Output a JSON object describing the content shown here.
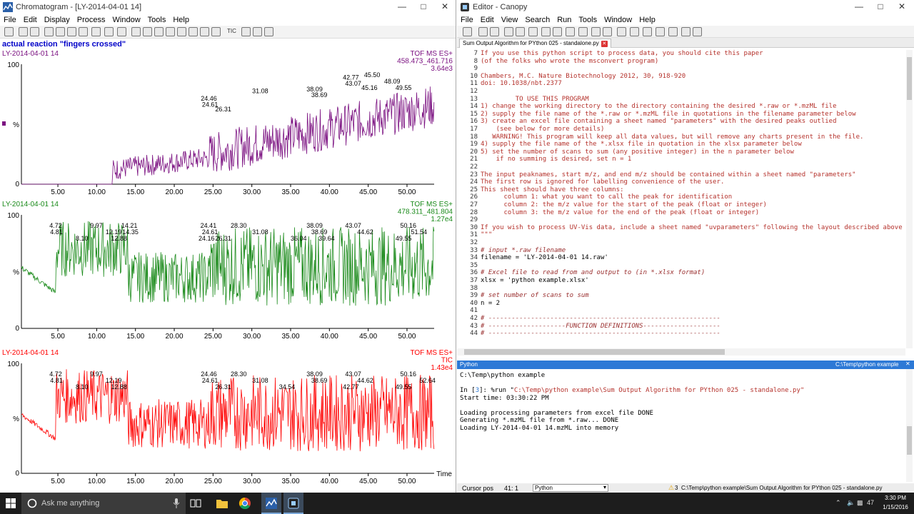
{
  "chromatogram": {
    "title": "Chromatogram - [LY-2014-04-01 14]",
    "menu": [
      "File",
      "Edit",
      "Display",
      "Process",
      "Window",
      "Tools",
      "Help"
    ],
    "toolbar_text": "TIC",
    "heading": "actual reaction \"fingers crossed\"",
    "time_label": "Time",
    "charts": [
      {
        "sample": "LY-2014-04-01 14",
        "method": "TOF MS ES+",
        "range": "458.473_461.716",
        "intensity": "3.64e3",
        "color": "#7b1181",
        "peak_labels": [
          "24.46",
          "24.61",
          "26.31",
          "31.08",
          "38.09",
          "38.69",
          "42.77",
          "43.07",
          "45.16",
          "45.50",
          "48.09",
          "49.55"
        ]
      },
      {
        "sample": "LY-2014-04-01 14",
        "method": "TOF MS ES+",
        "range": "478.311_481.804",
        "intensity": "1.27e4",
        "color": "#1a8a1a",
        "peak_labels": [
          "4.72",
          "4.81",
          "8.10",
          "9.97",
          "12.19",
          "12.88",
          "14.21",
          "14.35",
          "24.16",
          "24.41",
          "24.61",
          "26.31",
          "28.30",
          "31.08",
          "36.04",
          "38.09",
          "38.69",
          "39.64",
          "43.07",
          "44.62",
          "49.55",
          "50.16",
          "51.54"
        ]
      },
      {
        "sample": "LY-2014-04-01 14",
        "method": "TOF MS ES+",
        "range": "TIC",
        "intensity": "1.43e4",
        "color": "#ff0000",
        "peak_labels": [
          "4.72",
          "4.81",
          "8.10",
          "9.97",
          "12.19",
          "12.88",
          "24.46",
          "24.61",
          "26.31",
          "28.30",
          "31.08",
          "34.54",
          "38.09",
          "38.69",
          "42.77",
          "43.07",
          "44.62",
          "49.55",
          "50.16",
          "52.64"
        ]
      }
    ],
    "y_ticks": [
      "100",
      "%",
      "0"
    ],
    "x_ticks": [
      "5.00",
      "10.00",
      "15.00",
      "20.00",
      "25.00",
      "30.00",
      "35.00",
      "40.00",
      "45.00",
      "50.00"
    ]
  },
  "editor": {
    "title": "Editor - Canopy",
    "menu": [
      "File",
      "Edit",
      "View",
      "Search",
      "Run",
      "Tools",
      "Window",
      "Help"
    ],
    "tab": "Sum Output Algorithm for PYthon 025 - standalone.py",
    "code_lines": [
      {
        "n": "7",
        "t": "If you use this python script to process data, you should cite this paper",
        "k": "cm"
      },
      {
        "n": "8",
        "t": "(of the folks who wrote the msconvert program)",
        "k": "cm"
      },
      {
        "n": "9",
        "t": "",
        "k": "cm"
      },
      {
        "n": "10",
        "t": "Chambers, M.C. Nature Biotechnology 2012, 30, 918-920",
        "k": "cm"
      },
      {
        "n": "11",
        "t": "doi: 10.1038/nbt.2377",
        "k": "cm"
      },
      {
        "n": "12",
        "t": "",
        "k": "cm"
      },
      {
        "n": "13",
        "t": "         TO USE THIS PROGRAM",
        "k": "cm"
      },
      {
        "n": "14",
        "t": "1) change the working directory to the directory containing the desired *.raw or *.mzML file",
        "k": "cm"
      },
      {
        "n": "15",
        "t": "2) supply the file name of the *.raw or *.mzML file in quotations in the filename parameter below",
        "k": "cm"
      },
      {
        "n": "16",
        "t": "3) create an excel file containing a sheet named \"parameters\" with the desired peaks outlied",
        "k": "cm"
      },
      {
        "n": "17",
        "t": "    (see below for more details)",
        "k": "cm"
      },
      {
        "n": "18",
        "t": "   WARNING! This program will keep all data values, but will remove any charts present in the file.",
        "k": "cm"
      },
      {
        "n": "19",
        "t": "4) supply the file name of the *.xlsx file in quotation in the xlsx parameter below",
        "k": "cm"
      },
      {
        "n": "20",
        "t": "5) set the number of scans to sum (any positive integer) in the n parameter below",
        "k": "cm"
      },
      {
        "n": "21",
        "t": "    if no summing is desired, set n = 1",
        "k": "cm"
      },
      {
        "n": "22",
        "t": "",
        "k": "cm"
      },
      {
        "n": "23",
        "t": "The input peaknames, start m/z, and end m/z should be contained within a sheet named \"parameters\"",
        "k": "cm"
      },
      {
        "n": "24",
        "t": "The first row is ignored for labelling convenience of the user.",
        "k": "cm"
      },
      {
        "n": "25",
        "t": "This sheet should have three columns:",
        "k": "cm"
      },
      {
        "n": "26",
        "t": "      column 1: what you want to call the peak for identification",
        "k": "cm"
      },
      {
        "n": "27",
        "t": "      column 2: the m/z value for the start of the peak (float or integer)",
        "k": "cm"
      },
      {
        "n": "28",
        "t": "      column 3: the m/z value for the end of the peak (float or integer)",
        "k": "cm"
      },
      {
        "n": "29",
        "t": "",
        "k": "cm"
      },
      {
        "n": "30",
        "t": "If you wish to process UV-Vis data, include a sheet named \"uvparameters\" following the layout described above",
        "k": "cm"
      },
      {
        "n": "31",
        "t": "\"\"\"",
        "k": "cm"
      },
      {
        "n": "32",
        "t": "",
        "k": "tx"
      },
      {
        "n": "33",
        "t": "# input *.raw filename",
        "k": "it"
      },
      {
        "n": "34",
        "t": "filename = 'LY-2014-04-01 14.raw'",
        "k": "tx"
      },
      {
        "n": "35",
        "t": "",
        "k": "tx"
      },
      {
        "n": "36",
        "t": "# Excel file to read from and output to (in *.xlsx format)",
        "k": "it"
      },
      {
        "n": "37",
        "t": "xlsx = 'python example.xlsx'",
        "k": "tx"
      },
      {
        "n": "38",
        "t": "",
        "k": "tx"
      },
      {
        "n": "39",
        "t": "# set number of scans to sum",
        "k": "it"
      },
      {
        "n": "40",
        "t": "n = 2",
        "k": "tx"
      },
      {
        "n": "41",
        "t": "",
        "k": "tx"
      },
      {
        "n": "42",
        "t": "# ------------------------------------------------------------",
        "k": "it"
      },
      {
        "n": "43",
        "t": "# --------------------FUNCTION DEFINITIONS--------------------",
        "k": "it"
      },
      {
        "n": "44",
        "t": "# ------------------------------------------------------------",
        "k": "it"
      }
    ],
    "python_header": "Python",
    "python_path": "C:\\Temp\\python example",
    "console_lines": [
      "C:\\Temp\\python example",
      "",
      "In [3]: %run \"C:\\Temp\\python example\\Sum Output Algorithm for PYthon 025 - standalone.py\"",
      "Start time: 03:30:22 PM",
      "",
      "Loading processing parameters from excel file DONE",
      "Generating *.mzML file from *.raw... DONE",
      "Loading LY-2014-04-01 14.mzML into memory"
    ],
    "status": {
      "cursor_label": "Cursor pos",
      "cursor_value": "41: 1",
      "lang": "Python",
      "file_count": "3",
      "file_path": "C:\\Temp\\python example\\Sum Output Algorithm for PYthon 025 - standalone.py"
    }
  },
  "taskbar": {
    "search_placeholder": "Ask me anything",
    "tray_number": "47",
    "time": "3:30 PM",
    "date": "1/15/2016"
  },
  "colors": {
    "accent": "#2d79d6",
    "purple": "#7b1181",
    "green": "#1a8a1a",
    "red": "#ff0000"
  }
}
